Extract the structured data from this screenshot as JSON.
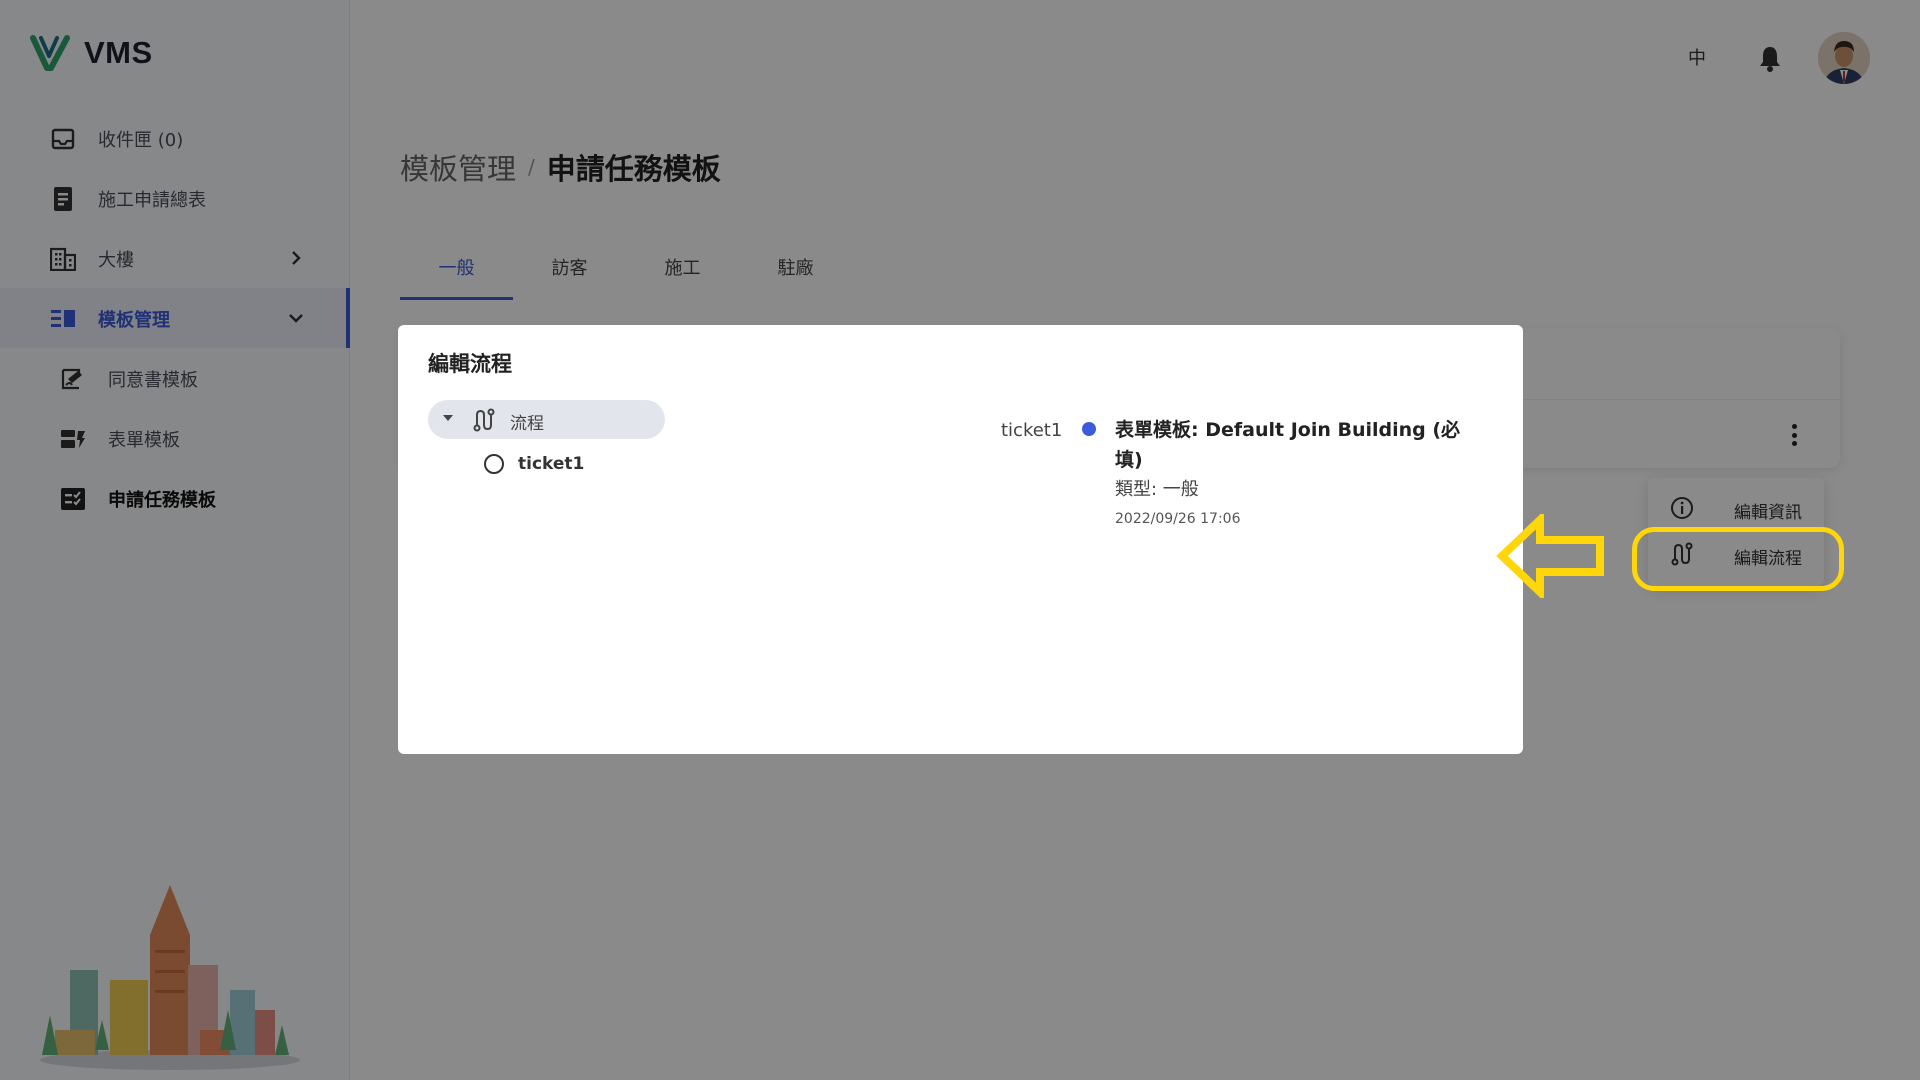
{
  "app": {
    "name": "VMS"
  },
  "sidebar": {
    "items": [
      {
        "label": "收件匣 (0)"
      },
      {
        "label": "施工申請總表"
      },
      {
        "label": "大樓"
      },
      {
        "label": "模板管理"
      },
      {
        "label": "同意書模板"
      },
      {
        "label": "表單模板"
      },
      {
        "label": "申請任務模板"
      }
    ]
  },
  "header": {
    "lang": "中"
  },
  "breadcrumb": {
    "parent": "模板管理",
    "separator": "/",
    "current": "申請任務模板"
  },
  "tabs": [
    {
      "label": "一般"
    },
    {
      "label": "訪客"
    },
    {
      "label": "施工"
    },
    {
      "label": "駐廠"
    }
  ],
  "context_menu": {
    "items": [
      {
        "label": "編輯資訊",
        "icon": "info-icon"
      },
      {
        "label": "編輯流程",
        "icon": "flow-icon"
      }
    ]
  },
  "dialog": {
    "title": "編輯流程",
    "tree": {
      "root_label": "流程",
      "child_label": "ticket1"
    },
    "timeline": {
      "label": "ticket1",
      "title": "表單模板: Default Join Building (必填)",
      "type": "類型: 一般",
      "date": "2022/09/26 17:06"
    }
  },
  "colors": {
    "accent": "#3d5bd9",
    "highlight": "#ffd60a",
    "overlay": "rgba(0,0,0,0.46)"
  }
}
